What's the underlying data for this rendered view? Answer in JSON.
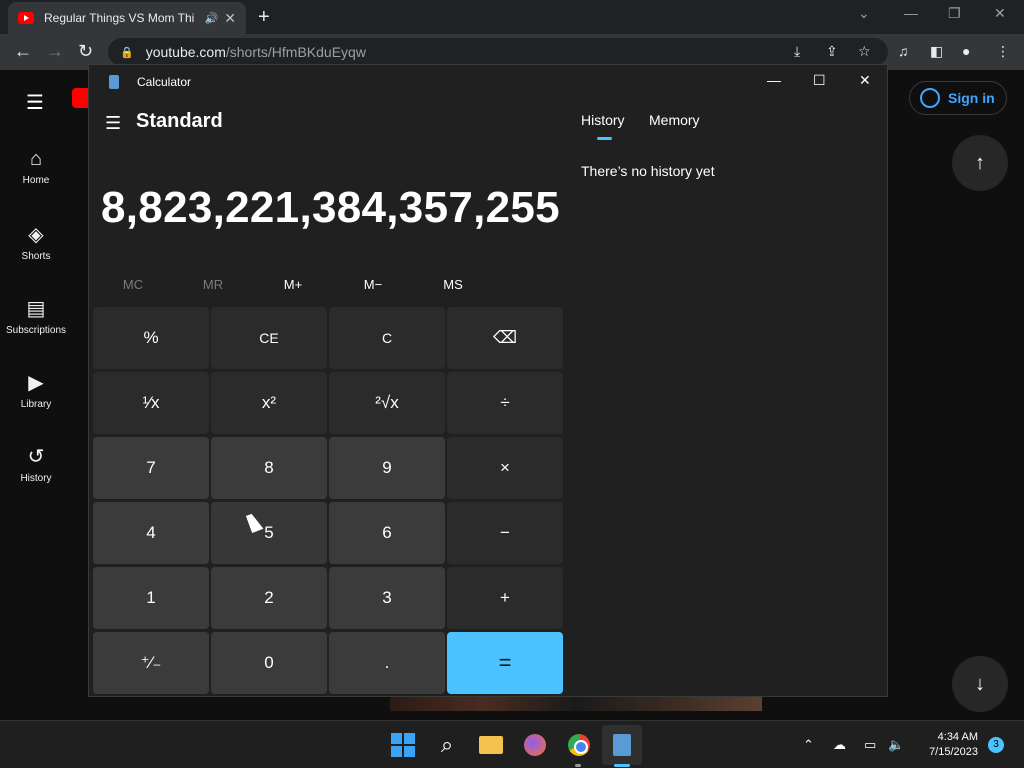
{
  "browser": {
    "tab_title": "Regular Things VS Mom Thi",
    "tab_audio_icon": "speaker-icon",
    "tab_close": "✕",
    "new_tab": "+",
    "url_host": "youtube.com",
    "url_path": "/shorts/HfmBKduEyqw"
  },
  "youtube": {
    "nav": [
      {
        "label": "Home"
      },
      {
        "label": "Shorts"
      },
      {
        "label": "Subscriptions"
      },
      {
        "label": "Library"
      },
      {
        "label": "History"
      }
    ],
    "sign_in": "Sign in"
  },
  "calculator": {
    "app_name": "Calculator",
    "mode": "Standard",
    "display": "8,823,221,384,357,255",
    "memory": [
      "MC",
      "MR",
      "M+",
      "M−",
      "MS"
    ],
    "keys": [
      "%",
      "CE",
      "C",
      "⌫",
      "¹⁄x",
      "x²",
      "²√x",
      "÷",
      "7",
      "8",
      "9",
      "×",
      "4",
      "5",
      "6",
      "−",
      "1",
      "2",
      "3",
      "+",
      "⁺⁄₋",
      "0",
      ".",
      "="
    ],
    "tabs": {
      "history": "History",
      "memory": "Memory"
    },
    "history_empty": "There’s no history yet"
  },
  "taskbar": {
    "time": "4:34 AM",
    "date": "7/15/2023",
    "notifications": "3"
  },
  "colors": {
    "accent": "#4cc2ff",
    "youtube_red": "#ff0000",
    "signin_blue": "#3ea6ff"
  }
}
